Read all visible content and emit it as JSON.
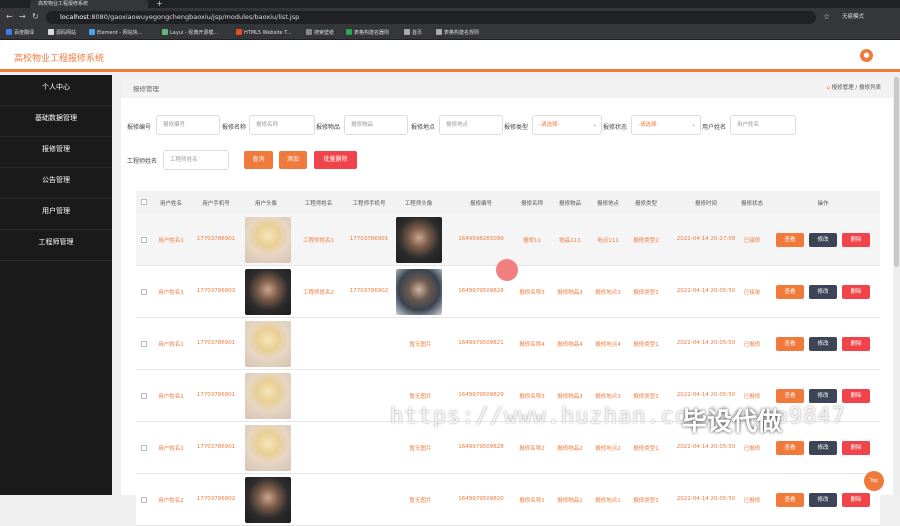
{
  "browser": {
    "tab_title": "高校物业工程报修系统",
    "url_host": "localhost",
    "url_path": ":8080/gaoxiaowuyegongchengbaoxiu/jsp/modules/baoxiu/list.jsp",
    "profile": "无痕模式",
    "bookmarks": [
      "百度翻译",
      "源码网站",
      "Element - 网站快...",
      "Layui - 经典开源模...",
      "HTML5 Website T...",
      "搜索壁纸",
      "表格构建名器则",
      "首页",
      "表格构建名规则"
    ]
  },
  "app": {
    "title": "高校物业工程报修系统",
    "avatar_icon": "user-icon"
  },
  "sidebar": {
    "items": [
      "个人中心",
      "基础数据管理",
      "报修管理",
      "公告管理",
      "用户管理",
      "工程师管理"
    ]
  },
  "page": {
    "section": "报修管理",
    "breadcrumb": "报修管理 / 报修列表",
    "home_icon": "home-icon"
  },
  "filters": {
    "f1": {
      "label": "报修编号",
      "placeholder": "报修编号"
    },
    "f2": {
      "label": "报修名称",
      "placeholder": "报修名称"
    },
    "f3": {
      "label": "报修物品",
      "placeholder": "报修物品"
    },
    "f4": {
      "label": "报修地点",
      "placeholder": "报修地点"
    },
    "f5": {
      "label": "报修类型",
      "value": "-请选择-"
    },
    "f6": {
      "label": "报修状态",
      "value": "-请选择-"
    },
    "f7": {
      "label": "用户姓名",
      "placeholder": "用户姓名"
    },
    "f8": {
      "label": "工程师姓名",
      "placeholder": "工程师姓名"
    }
  },
  "buttons": {
    "search": "查询",
    "add": "添加",
    "batch_delete": "批量删除"
  },
  "table": {
    "headers": [
      "用户姓名",
      "用户手机号",
      "用户头像",
      "工程师姓名",
      "工程师手机号",
      "工程师头像",
      "报修编号",
      "报修名称",
      "报修物品",
      "报修地点",
      "报修类型",
      "报修时间",
      "报修状态",
      "操作"
    ],
    "actions": {
      "view": "查看",
      "edit": "修改",
      "delete": "删除"
    },
    "rows": [
      {
        "user": "用户姓名1",
        "phone": "17703786901",
        "uimg": "girl",
        "eng": "工程师姓名1",
        "ephone": "17703786901",
        "eimg": "man1",
        "no": "1649598265099",
        "name": "报修11",
        "item": "物品111",
        "place": "地点111",
        "type": "报修类型2",
        "time": "2022-04-14 20:27:58",
        "status": "已接修"
      },
      {
        "user": "用户姓名3",
        "phone": "17703786903",
        "uimg": "man1",
        "eng": "工程师姓名2",
        "ephone": "17703786902",
        "eimg": "man2",
        "no": "1649979509828",
        "name": "报修名称3",
        "item": "报修物品3",
        "place": "报修地点3",
        "type": "报修类型1",
        "time": "2022-04-14 20:05:50",
        "status": "已接单"
      },
      {
        "user": "用户姓名1",
        "phone": "17703786901",
        "uimg": "girl",
        "eng": "",
        "ephone": "",
        "eimg": "",
        "no": "1649979509821",
        "name": "报修名称4",
        "item": "报修物品4",
        "place": "报修地点4",
        "type": "报修类型1",
        "time": "2022-04-14 20:05:50",
        "status": "已报修",
        "noimg": "暂无图片"
      },
      {
        "user": "用户姓名1",
        "phone": "17703786901",
        "uimg": "girl",
        "eng": "",
        "ephone": "",
        "eimg": "",
        "no": "1649979509829",
        "name": "报修名称3",
        "item": "报修物品3",
        "place": "报修地点3",
        "type": "报修类型2",
        "time": "2022-04-14 20:05:50",
        "status": "已报修",
        "noimg": "暂无图片"
      },
      {
        "user": "用户姓名1",
        "phone": "17703786901",
        "uimg": "girl",
        "eng": "",
        "ephone": "",
        "eimg": "",
        "no": "1649979509828",
        "name": "报修名称2",
        "item": "报修物品2",
        "place": "报修地点2",
        "type": "报修类型1",
        "time": "2022-04-14 20:05:50",
        "status": "已报修",
        "noimg": "暂无图片"
      },
      {
        "user": "用户姓名2",
        "phone": "17703786902",
        "uimg": "man1",
        "eng": "",
        "ephone": "",
        "eimg": "",
        "no": "1649979509820",
        "name": "报修名称1",
        "item": "报修物品1",
        "place": "报修地点1",
        "type": "报修类型1",
        "time": "2022-04-14 20:05:50",
        "status": "已报修",
        "noimg": "暂无图片"
      }
    ]
  },
  "overlay": {
    "watermark": "https://www.huzhan.com/ishop9847",
    "watermark2": "毕设代做",
    "top_button": "Top"
  }
}
